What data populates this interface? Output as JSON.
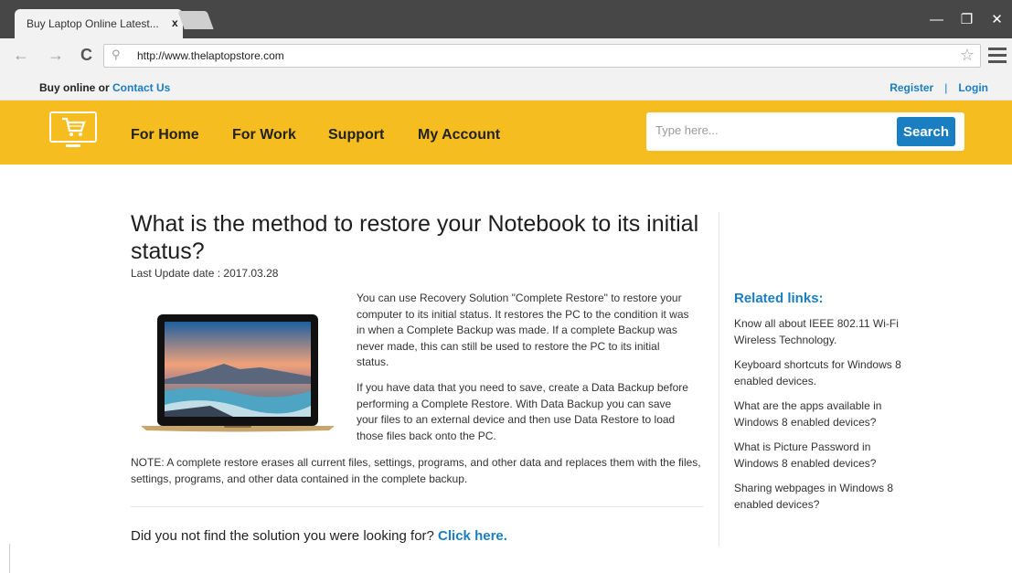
{
  "browser": {
    "tab_title": "Buy Laptop Online Latest...",
    "tab_close": "x",
    "url": "http://www.thelaptopstore.com",
    "icons": [
      "back-icon",
      "forward-icon",
      "reload-icon",
      "search-icon",
      "star-icon",
      "menu-icon",
      "minimize-icon",
      "maximize-icon",
      "close-icon"
    ]
  },
  "topbar": {
    "prefix": "Buy online or ",
    "contact": "Contact Us",
    "register": "Register",
    "separator": "|",
    "login": "Login"
  },
  "nav": {
    "items": [
      "For Home",
      "For Work",
      "Support",
      "My Account"
    ],
    "search_placeholder": "Type here...",
    "search_button": "Search"
  },
  "article": {
    "title": "What is the method to restore your Notebook to its initial status?",
    "update": "Last Update date : 2017.03.28",
    "p1": "You can use Recovery Solution \"Complete Restore\" to restore your computer to its initial status. It restores the PC to the condition it was in when a Complete Backup was made. If a complete Backup was never made, this can still be used to restore the PC to its initial status.",
    "p2": "If you have data that you need to save, create a Data Backup before performing a Complete Restore. With Data Backup you can save your files to an external device and then use Data Restore to load those files back onto the PC.",
    "note": "NOTE: A complete restore erases all current files, settings, programs, and other data and replaces them with the files, settings, programs, and other data contained in the complete backup.",
    "cta_text": "Did you not find the solution you were looking for? ",
    "cta_link": "Click here."
  },
  "sidebar": {
    "title": "Related links:",
    "links": [
      "Know all about IEEE 802.11 Wi-Fi Wireless Technology.",
      "Keyboard shortcuts for Windows 8 enabled devices.",
      "What are the apps available in Windows 8 enabled devices?",
      "What is Picture Password in Windows 8 enabled devices?",
      "Sharing webpages in Windows 8 enabled devices?"
    ]
  },
  "colors": {
    "brand": "#f5bd1f",
    "link": "#1a7ec2"
  }
}
